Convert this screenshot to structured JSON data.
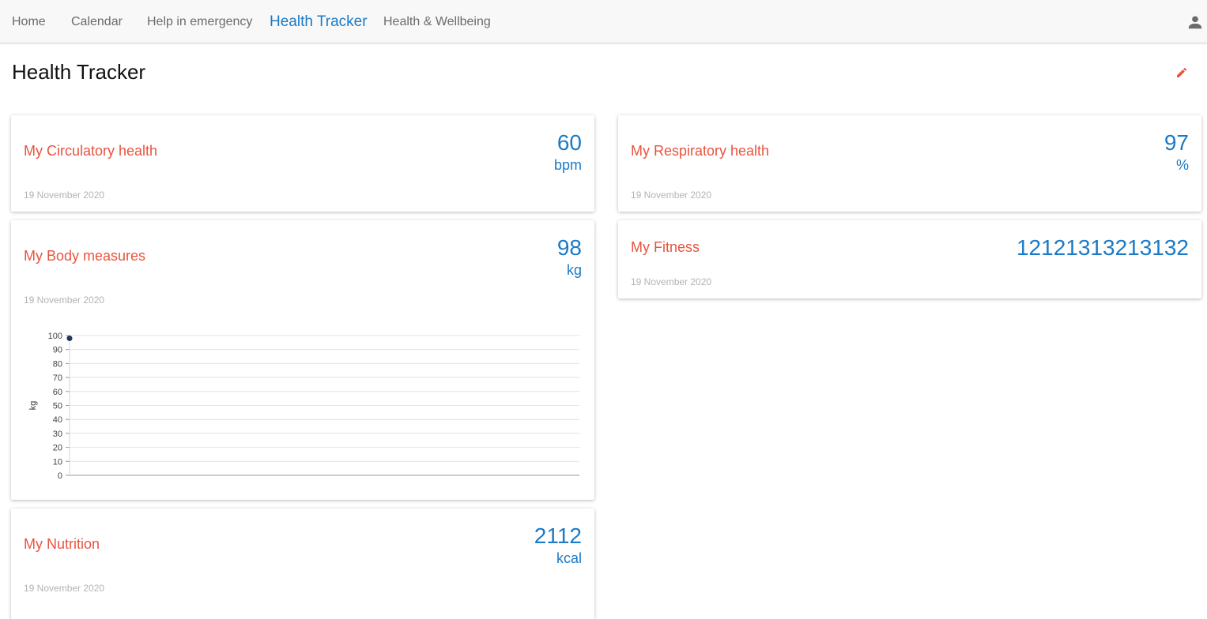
{
  "nav": {
    "items": [
      {
        "label": "Home",
        "active": false
      },
      {
        "label": "Calendar",
        "active": false
      },
      {
        "label": "Help in emergency",
        "active": false
      },
      {
        "label": "Health Tracker",
        "active": true
      },
      {
        "label": "Health & Wellbeing",
        "active": false
      }
    ],
    "user_icon": "person-icon"
  },
  "page": {
    "title": "Health Tracker",
    "edit_icon": "pencil-icon"
  },
  "cards": {
    "circulatory": {
      "title": "My Circulatory health",
      "value": "60",
      "unit": "bpm",
      "date": "19 November 2020"
    },
    "respiratory": {
      "title": "My Respiratory health",
      "value": "97",
      "unit": "%",
      "date": "19 November 2020"
    },
    "body": {
      "title": "My Body measures",
      "value": "98",
      "unit": "kg",
      "date": "19 November 2020"
    },
    "fitness": {
      "title": "My Fitness",
      "value": "12121313213132",
      "date": "19 November 2020"
    },
    "nutrition": {
      "title": "My Nutrition",
      "value": "2112",
      "unit": "kcal",
      "date": "19 November 2020"
    }
  },
  "colors": {
    "accent": "#1a7ac7",
    "card_title": "#e9533f",
    "date": "#b3b3b3",
    "chart_point": "#1e3a52"
  },
  "chart_data": {
    "type": "scatter",
    "ylabel": "kg",
    "xlabel": "",
    "ylim": [
      0,
      100
    ],
    "yticks": [
      "100",
      "90",
      "80",
      "70",
      "60",
      "50",
      "40",
      "30",
      "20",
      "10",
      "0"
    ],
    "series": [
      {
        "values": [
          98
        ]
      }
    ],
    "grid": true
  }
}
